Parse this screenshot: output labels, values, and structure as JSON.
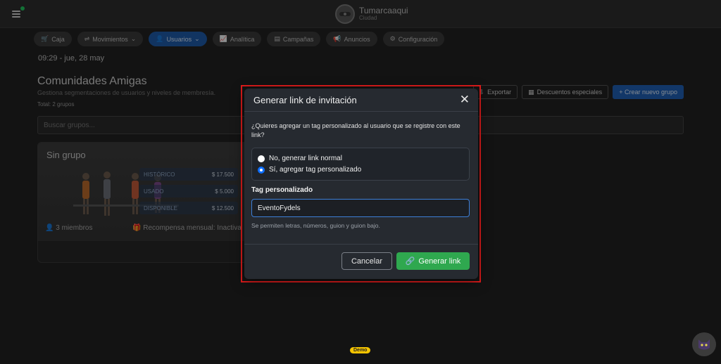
{
  "header": {
    "brand_name": "Tumarcaaqui",
    "brand_sub": "Ciudad"
  },
  "nav": [
    {
      "label": "Caja",
      "icon": "cart-icon"
    },
    {
      "label": "Movimientos",
      "icon": "movements-icon",
      "dropdown": true
    },
    {
      "label": "Usuarios",
      "icon": "user-icon",
      "dropdown": true,
      "active": true
    },
    {
      "label": "Analítica",
      "icon": "chart-icon"
    },
    {
      "label": "Campañas",
      "icon": "campaign-icon"
    },
    {
      "label": "Anuncios",
      "icon": "megaphone-icon"
    },
    {
      "label": "Configuración",
      "icon": "gear-icon"
    }
  ],
  "datetime": "09:29 - jue, 28 may",
  "page": {
    "title": "Comunidades Amigas",
    "subtitle": "Gestiona segmentaciones de usuarios y niveles de membresía.",
    "total": "Total: 2 grupos",
    "search_placeholder": "Buscar grupos..."
  },
  "actions": {
    "export": "Exportar",
    "discounts": "Descuentos especiales",
    "create": "+ Crear nuevo grupo"
  },
  "group_card": {
    "title": "Sin grupo",
    "stats": [
      {
        "label": "HISTÓRICO",
        "value": "$ 17.500"
      },
      {
        "label": "USADO",
        "value": "$ 5.000"
      },
      {
        "label": "DISPONIBLE",
        "value": "$ 12.500"
      }
    ],
    "members": "3 miembros",
    "reward": "Recompensa mensual: Inactiva"
  },
  "modal": {
    "title": "Generar link de invitación",
    "question": "¿Quieres agregar un tag personalizado al usuario que se registre con este link?",
    "option_normal": "No, generar link normal",
    "option_tag": "Sí, agregar tag personalizado",
    "selected_option": "option_tag",
    "tag_label": "Tag personalizado",
    "tag_value": "EventoFydels",
    "tag_help": "Se permiten letras, números, guion y guion bajo.",
    "cancel_label": "Cancelar",
    "generate_label": "Generar link"
  },
  "demo_badge": "Demo",
  "colors": {
    "primary": "#1f5fb3",
    "success": "#2fa84f",
    "highlight": "#e01b1b",
    "online": "#22c55e"
  }
}
